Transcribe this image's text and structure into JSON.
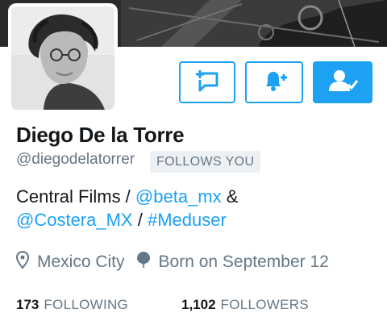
{
  "profile": {
    "display_name": "Diego De la Torre",
    "handle": "@diegodelatorrer",
    "follows_you_badge": "FOLLOWS YOU"
  },
  "bio": {
    "text_1": "Central Films / ",
    "link_1": "@beta_mx",
    "text_2": " &",
    "link_2": "@Costera_MX",
    "text_3": " / ",
    "link_3": "#Meduser"
  },
  "meta": {
    "location": "Mexico City",
    "birthday": "Born on September 12"
  },
  "stats": {
    "following_count": "173",
    "following_label": "FOLLOWING",
    "followers_count": "1,102",
    "followers_label": "FOLLOWERS"
  },
  "actions": {
    "dm_icon": "direct-message-icon",
    "notify_icon": "bell-plus-icon",
    "following_icon": "person-check-icon"
  },
  "colors": {
    "accent": "#1da1f2",
    "text_primary": "#14171a",
    "text_secondary": "#657786",
    "badge_bg": "#eef1f4"
  }
}
